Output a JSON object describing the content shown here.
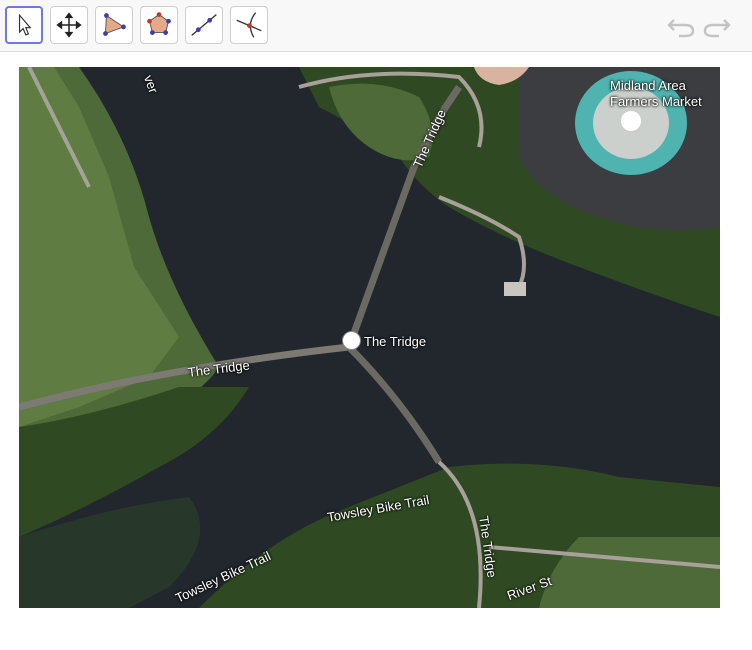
{
  "toolbar": {
    "tools": [
      {
        "id": "move",
        "icon": "arrow-pointer-icon",
        "active": true
      },
      {
        "id": "move-graphics",
        "icon": "move-arrows-icon",
        "active": false
      },
      {
        "id": "polygon",
        "icon": "polygon-icon",
        "active": false
      },
      {
        "id": "regular-polygon",
        "icon": "regular-polygon-icon",
        "active": false
      },
      {
        "id": "line",
        "icon": "line-through-points-icon",
        "active": false
      },
      {
        "id": "intersect",
        "icon": "intersect-icon",
        "active": false
      }
    ],
    "undo_icon": "undo-icon",
    "redo_icon": "redo-icon"
  },
  "map": {
    "labels": {
      "river_partial": "ver",
      "tridge_north": "The Tridge",
      "market_line1": "Midland Area",
      "market_line2": "Farmers Market",
      "tridge_center": "The Tridge",
      "tridge_west": "The Tridge",
      "towsley_right": "Towsley Bike Trail",
      "towsley_left": "Towsley Bike Trail",
      "tridge_south": "The Tridge",
      "river_st": "River St"
    },
    "colors": {
      "water": "#22272d",
      "grass": "#4d6a38",
      "trees": "#2f4a22",
      "path": "#a7a199",
      "bridge": "#6b6a62",
      "market_ring": "#4fb3b0"
    }
  }
}
